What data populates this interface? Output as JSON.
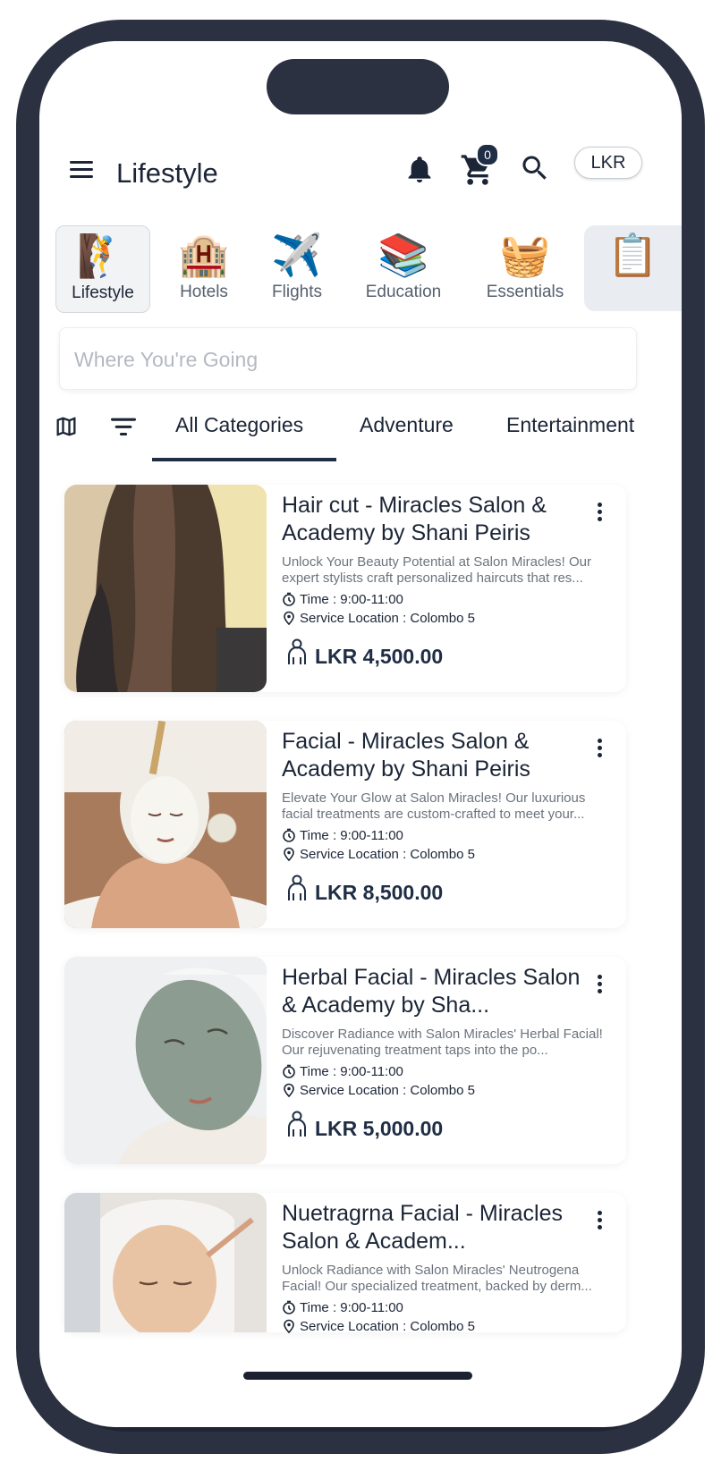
{
  "header": {
    "title": "Lifestyle",
    "cart_count": "0",
    "currency": "LKR"
  },
  "categories": [
    {
      "label": "Lifestyle",
      "icon": "lifestyle-climber-icon",
      "glyph": "🧗"
    },
    {
      "label": "Hotels",
      "icon": "hotel-icon",
      "glyph": "🏨"
    },
    {
      "label": "Flights",
      "icon": "airplane-icon",
      "glyph": "✈️"
    },
    {
      "label": "Education",
      "icon": "books-icon",
      "glyph": "📚"
    },
    {
      "label": "Essentials",
      "icon": "basket-icon",
      "glyph": "🧺"
    },
    {
      "label": "",
      "icon": "clipboard-icon",
      "glyph": "📋"
    }
  ],
  "search": {
    "placeholder": "Where You're Going"
  },
  "tabs": [
    "All Categories",
    "Adventure",
    "Entertainment"
  ],
  "listings": [
    {
      "title": "Hair cut - Miracles Salon & Academy by Shani Peiris",
      "title_display": "Hair cut - Miracles Salon &amp; Academy by Shani Peiris",
      "description": "Unlock Your Beauty Potential at Salon Miracles! Our expert stylists craft personalized haircuts that res...",
      "time": "Time : 9:00-11:00",
      "location": "Service Location : Colombo 5",
      "price": "LKR 4,500.00"
    },
    {
      "title": "Facial - Miracles Salon & Academy by Shani Peiris",
      "description": "Elevate Your Glow at Salon Miracles! Our luxurious facial treatments are custom-crafted to meet your...",
      "time": "Time : 9:00-11:00",
      "location": "Service Location : Colombo 5",
      "price": "LKR 8,500.00"
    },
    {
      "title": "Herbal Facial - Miracles Salon & Academy by Sha...",
      "description": "Discover Radiance with Salon Miracles' Herbal Facial! Our rejuvenating treatment taps into the po...",
      "time": "Time : 9:00-11:00",
      "location": "Service Location : Colombo 5",
      "price": "LKR 5,000.00"
    },
    {
      "title": "Nuetragrna Facial - Miracles Salon & Academ...",
      "description": "Unlock Radiance with Salon Miracles' Neutrogena Facial! Our specialized treatment, backed by derm...",
      "time": "Time : 9:00-11:00",
      "location": "Service Location : Colombo 5",
      "price": ""
    }
  ],
  "colors": {
    "primary": "#1f2d45",
    "frame": "#2b3140",
    "muted_text": "#6c737e"
  }
}
